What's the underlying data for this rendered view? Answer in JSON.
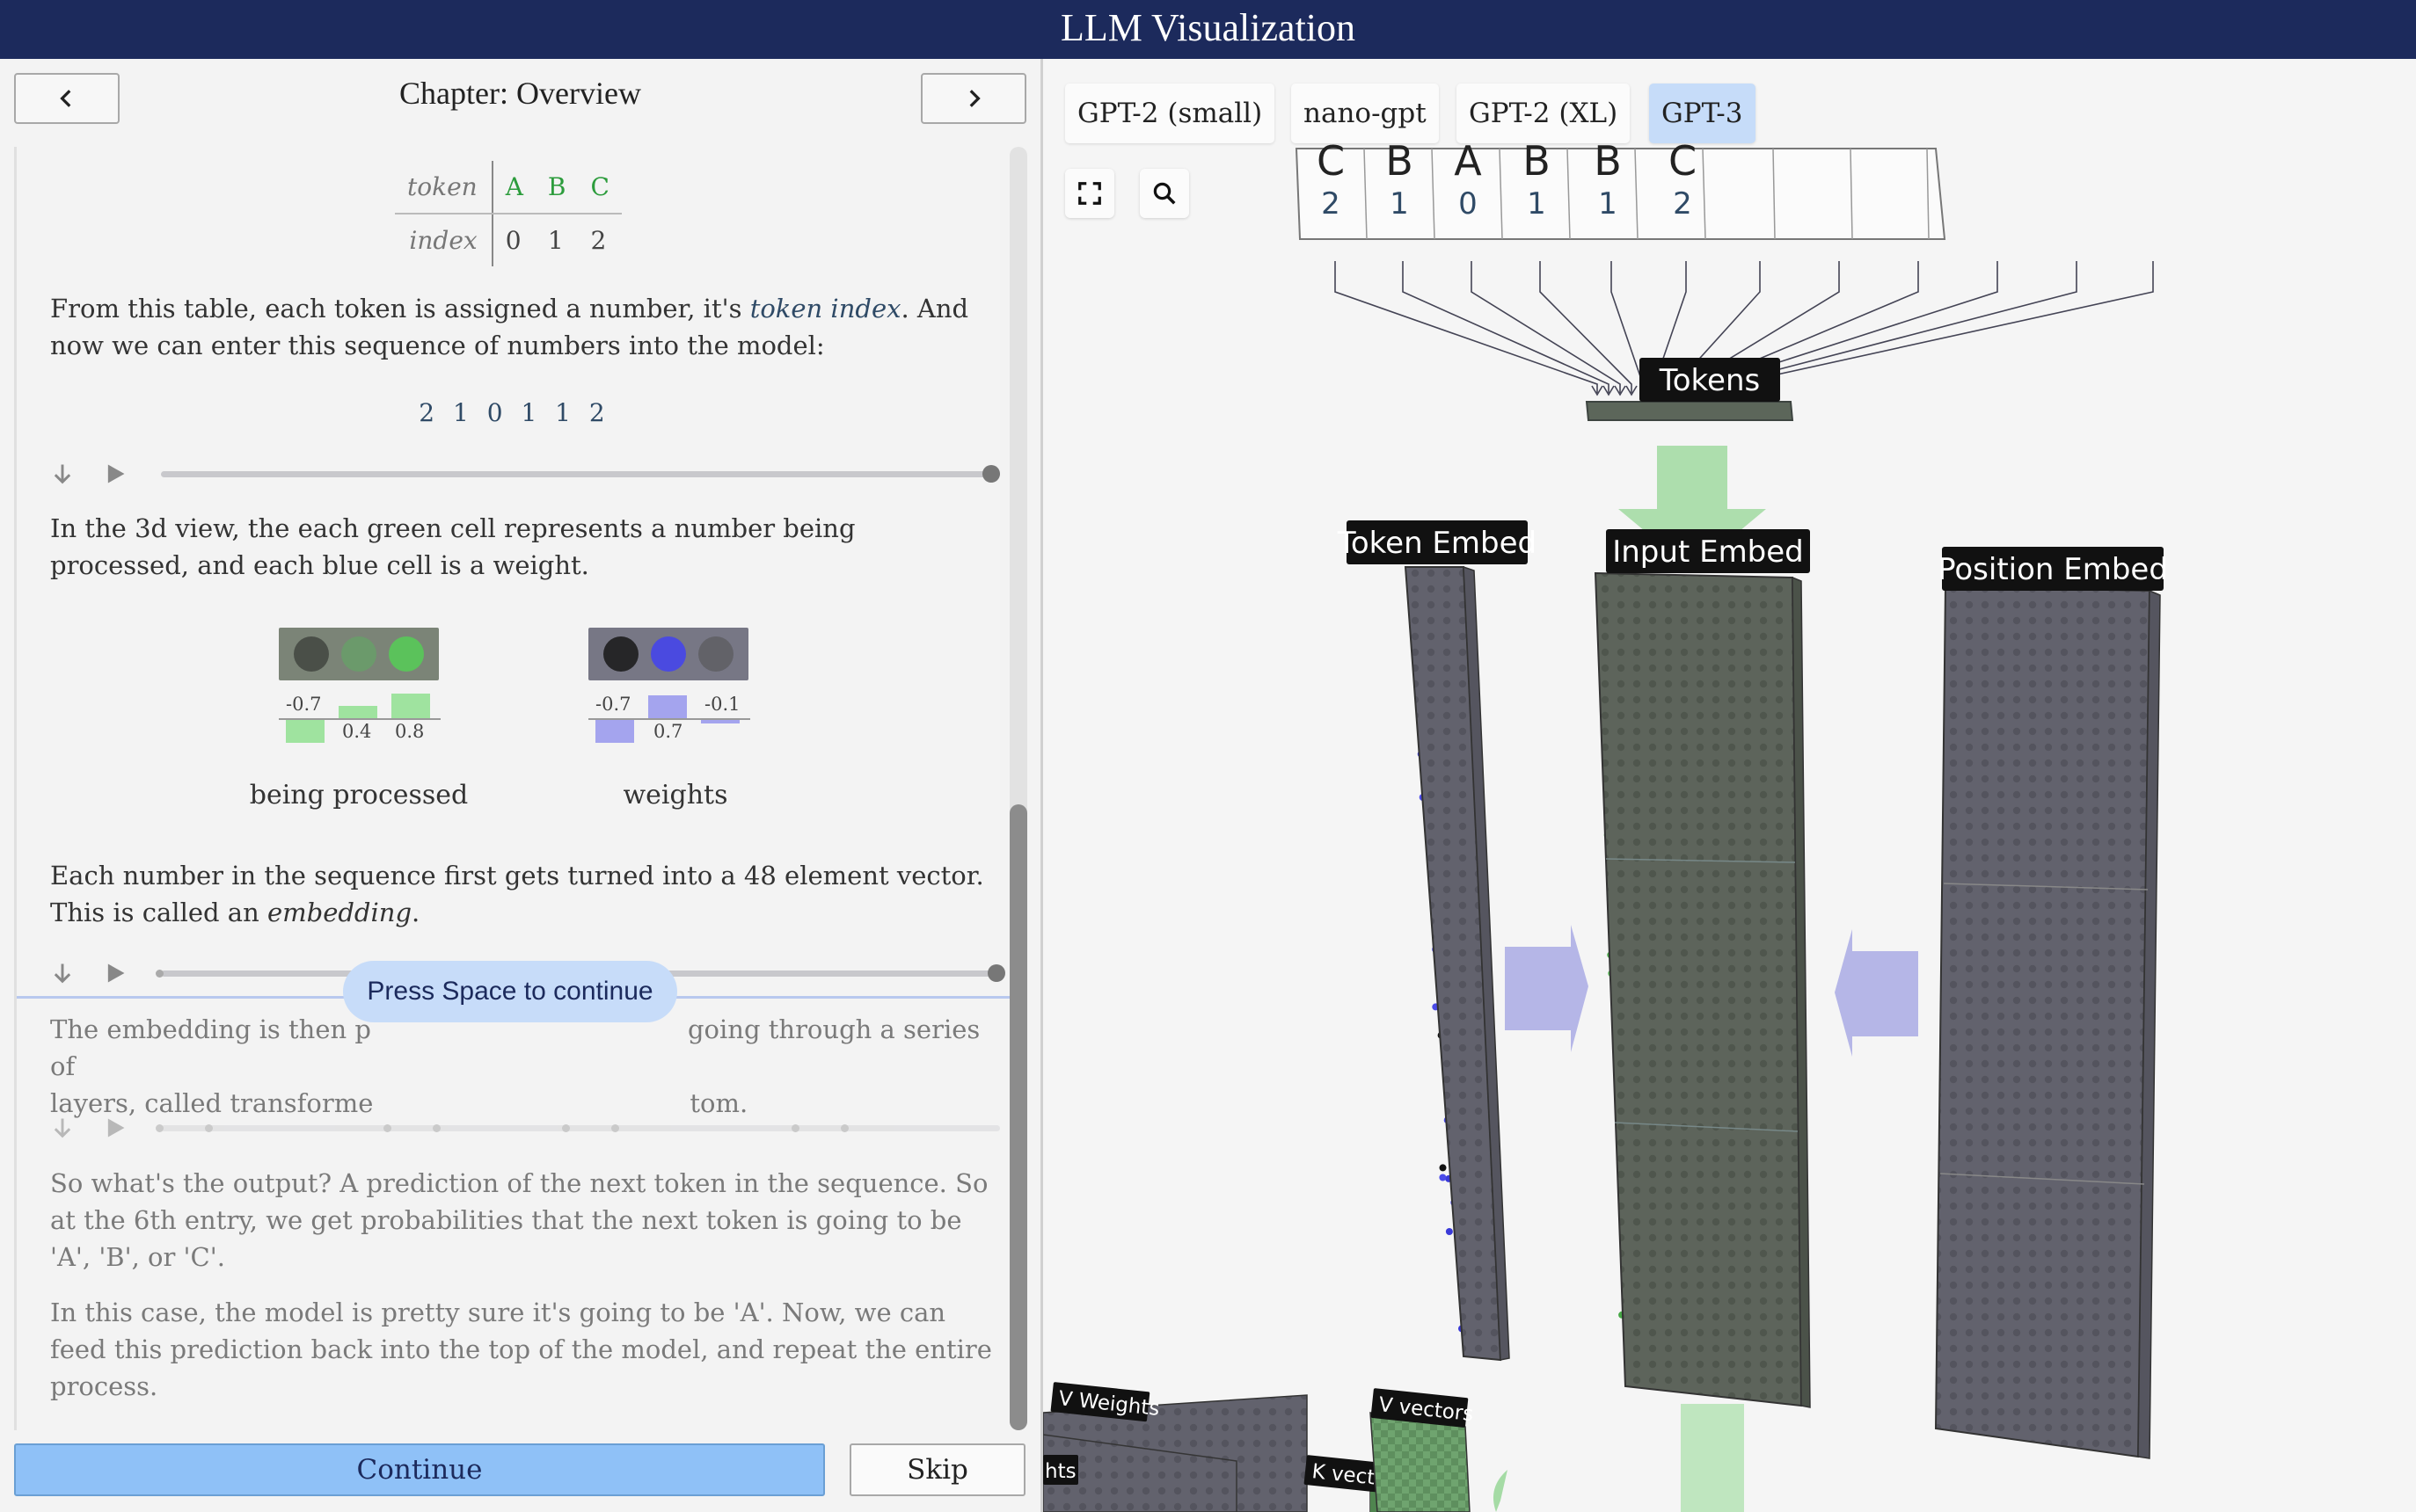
{
  "app": {
    "title": "LLM Visualization"
  },
  "chapter": {
    "title": "Chapter: Overview",
    "prev_icon": "chevron-left-icon",
    "next_icon": "chevron-right-icon"
  },
  "token_table": {
    "row_labels": [
      "token",
      "index"
    ],
    "tokens": [
      "A",
      "B",
      "C"
    ],
    "indices": [
      "0",
      "1",
      "2"
    ]
  },
  "paragraphs": {
    "p1_a": "From this table, each token is assigned a number, it's ",
    "p1_link": "token index",
    "p1_b": ". And now we can enter this sequence of numbers into the model:",
    "sequence": "2 1 0 1 1 2",
    "p2": "In the 3d view, the each green cell represents a number being processed, and each blue cell is a weight.",
    "p3_a": "Each number in the sequence first gets turned into a 48 element vector. This is called an ",
    "p3_em": "embedding",
    "p3_b": ".",
    "p4_a": "The embedding is then p",
    "p4_b": "going through a series of",
    "p4_c": "layers, called transforme",
    "p4_d": "tom.",
    "p5": "So what's the output? A prediction of the next token in the sequence. So at the 6th entry, we get probabilities that the next token is going to be 'A', 'B', or 'C'.",
    "p6": "In this case, the model is pretty sure it's going to be 'A'. Now, we can feed this prediction back into the top of the model, and repeat the entire process."
  },
  "legend": {
    "processed": {
      "caption": "being processed",
      "values": [
        "-0.7",
        "0.4",
        "0.8"
      ]
    },
    "weights": {
      "caption": "weights",
      "values": [
        "-0.7",
        "0.7",
        "-0.1"
      ]
    }
  },
  "tooltip": "Press Space to continue",
  "buttons": {
    "continue": "Continue",
    "skip": "Skip"
  },
  "model_tabs": [
    "GPT-2 (small)",
    "nano-gpt",
    "GPT-2 (XL)",
    "GPT-3"
  ],
  "active_tab": "GPT-3",
  "view_icons": [
    "fullscreen-icon",
    "search-icon"
  ],
  "scene": {
    "input_tokens": [
      {
        "token": "C",
        "index": "2"
      },
      {
        "token": "B",
        "index": "1"
      },
      {
        "token": "A",
        "index": "0"
      },
      {
        "token": "B",
        "index": "1"
      },
      {
        "token": "B",
        "index": "1"
      },
      {
        "token": "C",
        "index": "2"
      }
    ],
    "labels": {
      "tokens": "Tokens",
      "token_embed": "Token Embed",
      "input_embed": "Input Embed",
      "position_embed": "Position Embed",
      "v_weights": "V Weights",
      "weights_partial": "hts",
      "v_vectors": "V vectors",
      "k_vectors": "K vectors"
    }
  },
  "colors": {
    "header": "#1c2a5c",
    "accent_blue": "#8fc1f7",
    "processed_green": "#2c9c3c",
    "weight_blue": "#4a4ae0"
  }
}
